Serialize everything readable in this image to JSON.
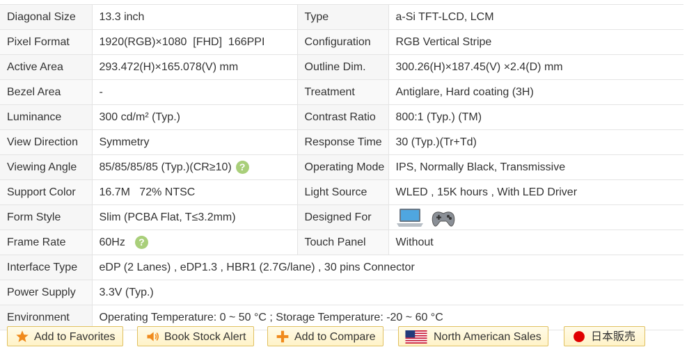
{
  "specs": [
    {
      "l1": "Diagonal Size",
      "v1": "13.3 inch",
      "l2": "Type",
      "v2": "a-Si TFT-LCD, LCM"
    },
    {
      "l1": "Pixel Format",
      "v1": "1920(RGB)×1080  [FHD]  166PPI",
      "l2": "Configuration",
      "v2": "RGB Vertical Stripe"
    },
    {
      "l1": "Active Area",
      "v1": "293.472(H)×165.078(V) mm",
      "l2": "Outline Dim.",
      "v2": "300.26(H)×187.45(V) ×2.4(D) mm"
    },
    {
      "l1": "Bezel Area",
      "v1": "-",
      "l2": "Treatment",
      "v2": "Antiglare, Hard coating (3H)"
    },
    {
      "l1": "Luminance",
      "v1": "300 cd/m² (Typ.)",
      "l2": "Contrast Ratio",
      "v2": "800:1 (Typ.) (TM)"
    },
    {
      "l1": "View Direction",
      "v1": "Symmetry",
      "l2": "Response Time",
      "v2": "30 (Typ.)(Tr+Td)"
    },
    {
      "l1": "Viewing Angle",
      "v1": "85/85/85/85 (Typ.)(CR≥10)",
      "l2": "Operating Mode",
      "v2": "IPS, Normally Black, Transmissive"
    },
    {
      "l1": "Support Color",
      "v1": "16.7M   72% NTSC",
      "l2": "Light Source",
      "v2": "WLED , 15K hours , With LED Driver"
    },
    {
      "l1": "Form Style",
      "v1": "Slim (PCBA Flat, T≤3.2mm)",
      "l2": "Designed For",
      "v2": ""
    },
    {
      "l1": "Frame Rate",
      "v1": "60Hz",
      "l2": "Touch Panel",
      "v2": "Without"
    },
    {
      "l1": "Interface Type",
      "v1": "eDP (2 Lanes) , eDP1.3 , HBR1 (2.7G/lane) , 30 pins Connector"
    },
    {
      "l1": "Power Supply",
      "v1": "3.3V (Typ.)"
    },
    {
      "l1": "Environment",
      "v1": "Operating Temperature: 0 ~ 50 °C ; Storage Temperature: -20 ~ 60 °C"
    }
  ],
  "help_glyph": "?",
  "designed_for_icons": [
    "laptop-icon",
    "gamepad-icon"
  ],
  "actions": {
    "favorites": "Add to Favorites",
    "stock_alert": "Book Stock Alert",
    "compare": "Add to Compare",
    "na_sales": "North American Sales",
    "jp_sales": "日本販売"
  },
  "colors": {
    "link": "#3a5a8c",
    "help": "#a9cf7a",
    "button_border": "#e0c060",
    "star": "#f08a1c",
    "plus": "#f08a1c",
    "jp_dot": "#e00000"
  }
}
